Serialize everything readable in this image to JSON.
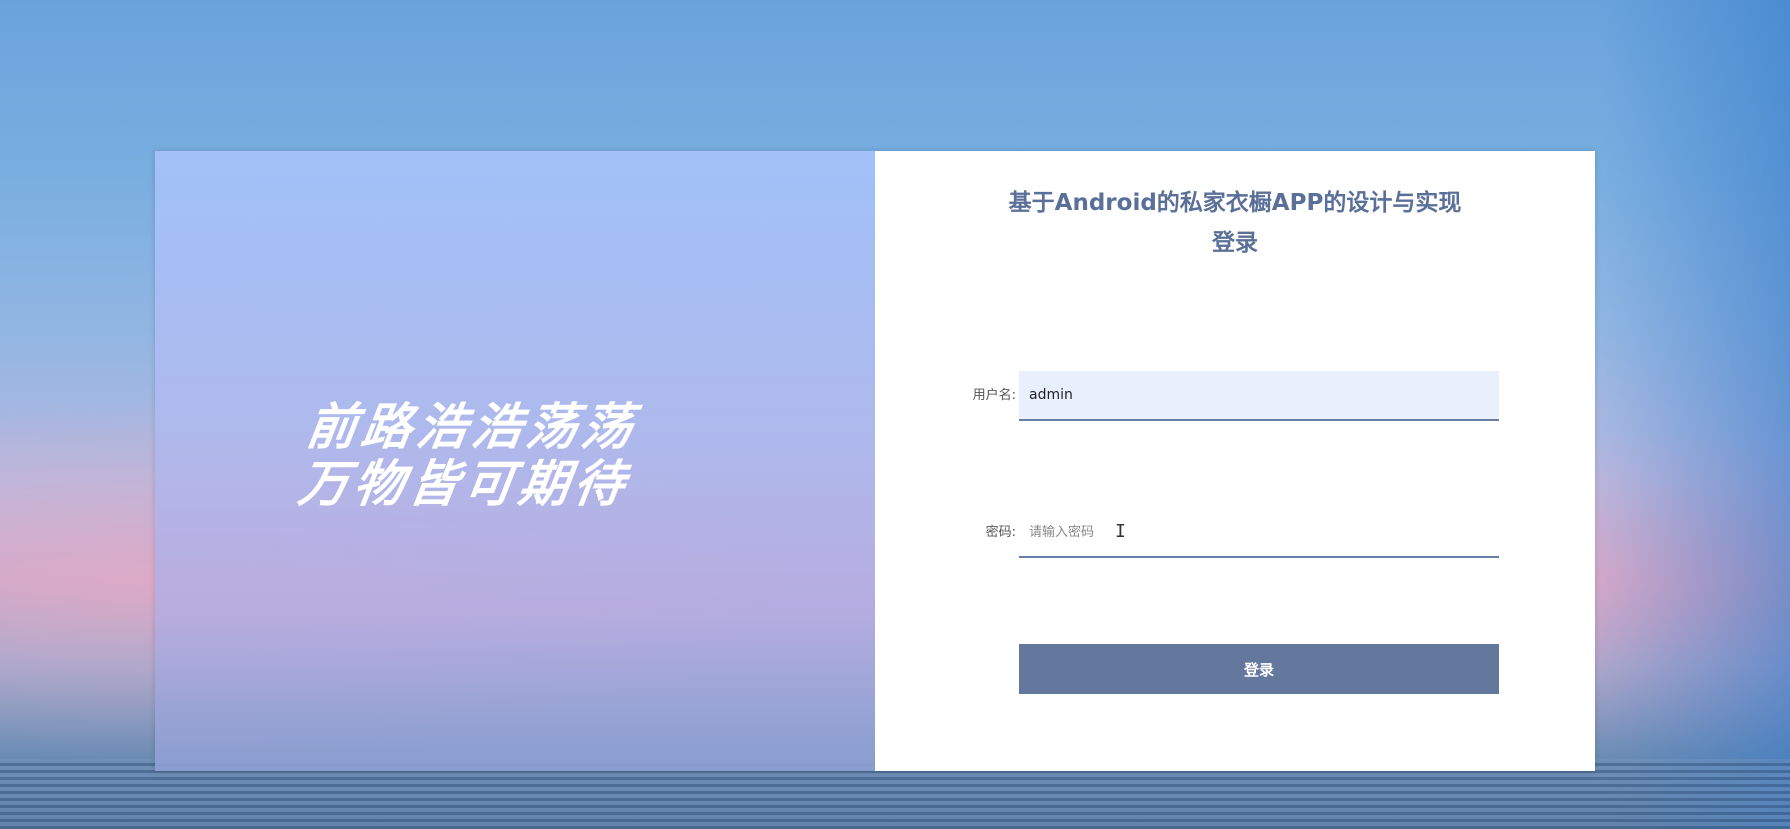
{
  "slogan": {
    "line1": "前路浩浩荡荡",
    "line2": "万物皆可期待"
  },
  "login": {
    "title_line1": "基于Android的私家衣橱APP的设计与实现",
    "title_line2": "登录",
    "username": {
      "label": "用户名:",
      "value": "admin"
    },
    "password": {
      "label": "密码:",
      "placeholder": "请输入密码",
      "value": ""
    },
    "submit_label": "登录"
  },
  "colors": {
    "accent": "#64779c",
    "title": "#5b7098",
    "input_underline": "#6a7fa6",
    "autofill_bg": "#e8f0fe"
  },
  "icons": {
    "cursor": "text-cursor-icon"
  }
}
